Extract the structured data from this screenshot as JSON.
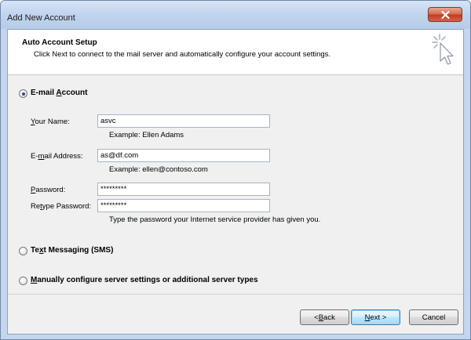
{
  "window": {
    "title": "Add New Account"
  },
  "header": {
    "title": "Auto Account Setup",
    "subtitle": "Click Next to connect to the mail server and automatically configure your account settings."
  },
  "options": {
    "email": {
      "pre": "E-mail ",
      "access": "A",
      "post": "ccount",
      "checked": true
    },
    "sms": {
      "pre": "Te",
      "access": "x",
      "post": "t Messaging (SMS)",
      "checked": false
    },
    "manual": {
      "pre": "",
      "access": "M",
      "post": "anually configure server settings or additional server types",
      "checked": false
    }
  },
  "form": {
    "name": {
      "pre": "",
      "access": "Y",
      "post": "our Name:",
      "value": "asvc",
      "hint": "Example: Ellen Adams"
    },
    "email": {
      "pre": "E-",
      "access": "m",
      "post": "ail Address:",
      "value": "as@df.com",
      "hint": "Example: ellen@contoso.com"
    },
    "password": {
      "pre": "",
      "access": "P",
      "post": "assword:",
      "value": "*********"
    },
    "retype": {
      "pre": "Re",
      "access": "t",
      "post": "ype Password:",
      "value": "*********",
      "hint": "Type the password your Internet service provider has given you."
    }
  },
  "buttons": {
    "back": {
      "pre": "< ",
      "access": "B",
      "post": "ack"
    },
    "next": {
      "pre": "",
      "access": "N",
      "post": "ext >"
    },
    "cancel": {
      "label": "Cancel"
    }
  },
  "icons": {
    "close": "close-icon",
    "setup": "cursor-sparkle-icon"
  }
}
